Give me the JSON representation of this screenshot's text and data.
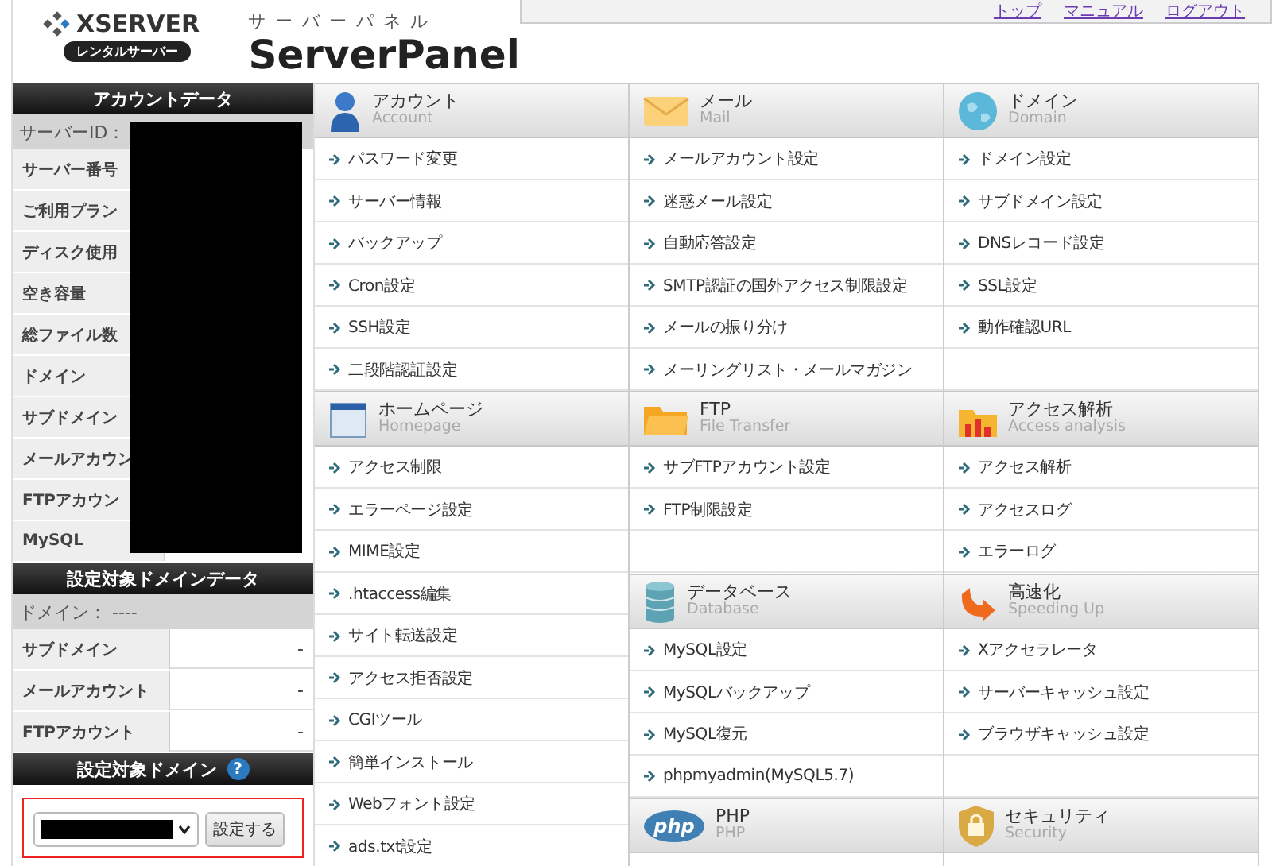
{
  "header": {
    "logo": "XSERVER",
    "logo_badge": "レンタルサーバー",
    "kana_title": "サーバーパネル",
    "title": "ServerPanel",
    "links": [
      "トップ",
      "マニュアル",
      "ログアウト"
    ]
  },
  "sidebar": {
    "account_title": "アカウントデータ",
    "server_id_label": "サーバーID：",
    "rows": [
      {
        "label": "サーバー番号"
      },
      {
        "label": "ご利用プラン"
      },
      {
        "label": "ディスク使用"
      },
      {
        "label": "空き容量"
      },
      {
        "label": "総ファイル数"
      },
      {
        "label": "ドメイン"
      },
      {
        "label": "サブドメイン"
      },
      {
        "label": "メールアカウン"
      },
      {
        "label": "FTPアカウン"
      },
      {
        "label": "MySQL"
      }
    ],
    "domain_title": "設定対象ドメインデータ",
    "domain_label": "ドメイン： ----",
    "domain_rows": [
      {
        "label": "サブドメイン",
        "value": "-"
      },
      {
        "label": "メールアカウント",
        "value": "-"
      },
      {
        "label": "FTPアカウント",
        "value": "-"
      }
    ],
    "select_title": "設定対象ドメイン",
    "help": "?",
    "set_button": "設定する"
  },
  "columns": [
    {
      "sections": [
        {
          "kind": "account",
          "title": "アカウント",
          "subtitle": "Account",
          "items": [
            "パスワード変更",
            "サーバー情報",
            "バックアップ",
            "Cron設定",
            "SSH設定",
            "二段階認証設定"
          ]
        },
        {
          "kind": "homepage",
          "title": "ホームページ",
          "subtitle": "Homepage",
          "items": [
            "アクセス制限",
            "エラーページ設定",
            "MIME設定",
            ".htaccess編集",
            "サイト転送設定",
            "アクセス拒否設定",
            "CGIツール",
            "簡単インストール",
            "Webフォント設定",
            "ads.txt設定"
          ]
        }
      ]
    },
    {
      "sections": [
        {
          "kind": "mail",
          "title": "メール",
          "subtitle": "Mail",
          "items": [
            "メールアカウント設定",
            "迷惑メール設定",
            "自動応答設定",
            "SMTP認証の国外アクセス制限設定",
            "メールの振り分け",
            "メーリングリスト・メールマガジン"
          ]
        },
        {
          "kind": "ftp",
          "title": "FTP",
          "subtitle": "File Transfer",
          "items": [
            "サブFTPアカウント設定",
            "FTP制限設定"
          ]
        },
        {
          "kind": "database",
          "title": "データベース",
          "subtitle": "Database",
          "items": [
            "MySQL設定",
            "MySQLバックアップ",
            "MySQL復元",
            "phpmyadmin(MySQL5.7)"
          ]
        },
        {
          "kind": "php",
          "title": "PHP",
          "subtitle": "PHP",
          "icon_text": "php"
        }
      ]
    },
    {
      "sections": [
        {
          "kind": "domain",
          "title": "ドメイン",
          "subtitle": "Domain",
          "items": [
            "ドメイン設定",
            "サブドメイン設定",
            "DNSレコード設定",
            "SSL設定",
            "動作確認URL"
          ]
        },
        {
          "kind": "analysis",
          "title": "アクセス解析",
          "subtitle": "Access analysis",
          "items": [
            "アクセス解析",
            "アクセスログ",
            "エラーログ"
          ]
        },
        {
          "kind": "speed",
          "title": "高速化",
          "subtitle": "Speeding Up",
          "items": [
            "Xアクセラレータ",
            "サーバーキャッシュ設定",
            "ブラウザキャッシュ設定"
          ]
        },
        {
          "kind": "security",
          "title": "セキュリティ",
          "subtitle": "Security"
        }
      ]
    }
  ]
}
